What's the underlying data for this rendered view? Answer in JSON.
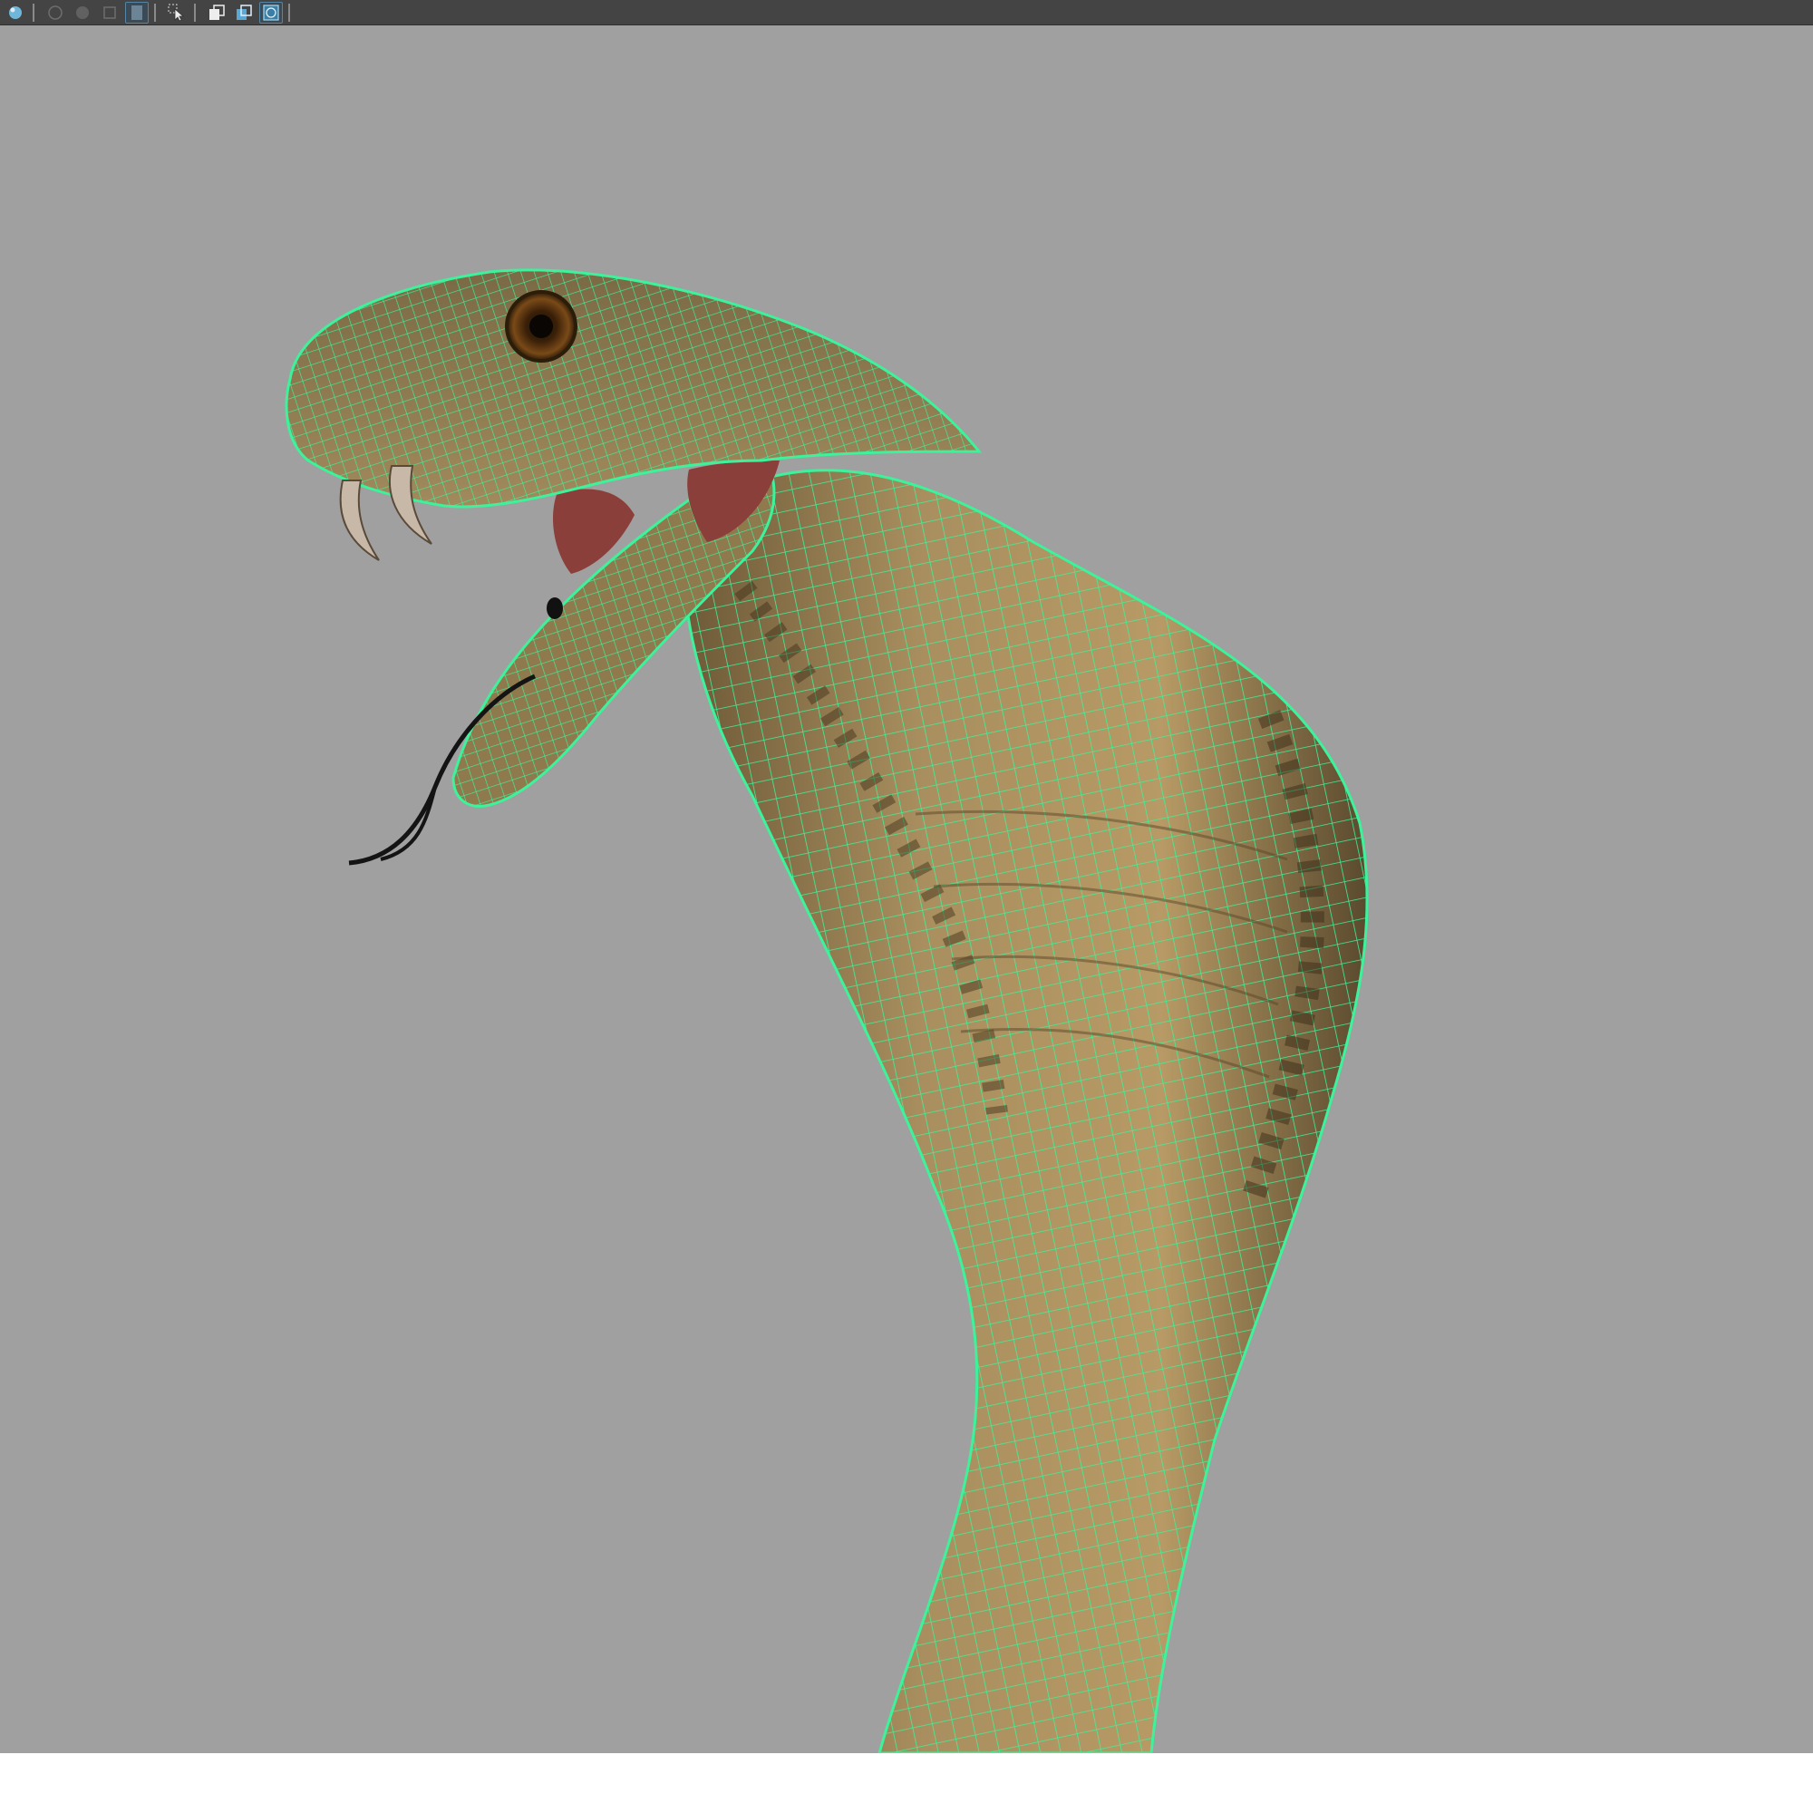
{
  "toolbar": {
    "buttons": [
      {
        "icon": "sphere-shaded-icon",
        "state": "enabled"
      },
      {
        "icon": "wireframe-sphere-icon",
        "state": "disabled"
      },
      {
        "icon": "smooth-shade-icon",
        "state": "disabled"
      },
      {
        "icon": "bounding-box-icon",
        "state": "disabled"
      },
      {
        "icon": "flat-shade-icon",
        "state": "active"
      },
      {
        "icon": "select-cursor-icon",
        "state": "enabled"
      },
      {
        "icon": "isolate-select-icon",
        "state": "enabled"
      },
      {
        "icon": "xray-icon",
        "state": "enabled"
      },
      {
        "icon": "wireframe-on-shaded-icon",
        "state": "active"
      }
    ]
  },
  "viewport": {
    "background_color": "#a0a0a0",
    "wireframe_color": "#3cf29a",
    "model": "cobra-wireframe-on-shaded"
  }
}
